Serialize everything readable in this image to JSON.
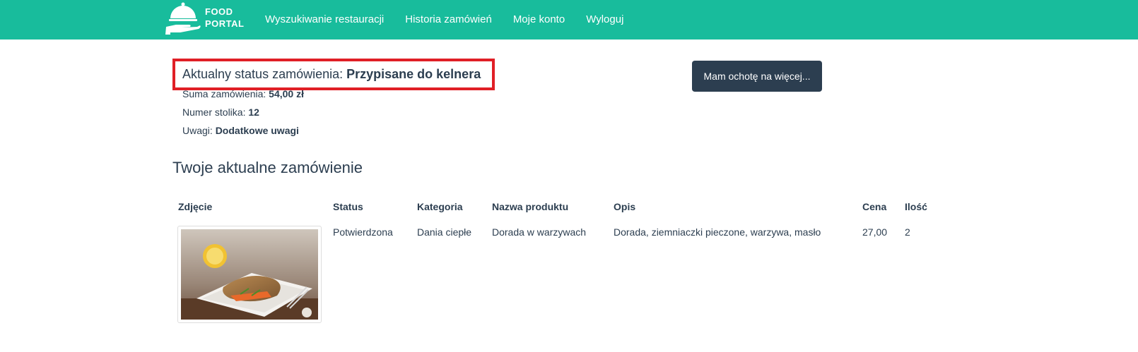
{
  "brand": {
    "line1": "FOOD",
    "line2": "PORTAL",
    "icon": "cloche-tray-icon"
  },
  "nav": {
    "items": [
      {
        "label": "Wyszukiwanie restauracji"
      },
      {
        "label": "Historia zamówień"
      },
      {
        "label": "Moje konto"
      },
      {
        "label": "Wyloguj"
      }
    ]
  },
  "order": {
    "status_label": "Aktualny status zamówienia: ",
    "status_value": "Przypisane do kelnera",
    "sum_label": "Suma zamówienia: ",
    "sum_value": "54,00 zł",
    "table_label": "Numer stolika: ",
    "table_value": "12",
    "notes_label": "Uwagi: ",
    "notes_value": "Dodatkowe uwagi"
  },
  "more_button": "Mam ochotę na więcej...",
  "section_title": "Twoje aktualne zamówienie",
  "table": {
    "headers": [
      "Zdjęcie",
      "Status",
      "Kategoria",
      "Nazwa produktu",
      "Opis",
      "Cena",
      "Ilość"
    ],
    "rows": [
      {
        "image": "fish-dish-photo",
        "status": "Potwierdzona",
        "category": "Dania ciepłe",
        "name": "Dorada w warzywach",
        "description": "Dorada, ziemniaczki pieczone, warzywa, masło",
        "price": "27,00",
        "qty": "2"
      }
    ]
  },
  "colors": {
    "navbar": "#18bc9c",
    "text": "#2c3e50",
    "button": "#2c3e50",
    "highlight": "#e01f26"
  }
}
